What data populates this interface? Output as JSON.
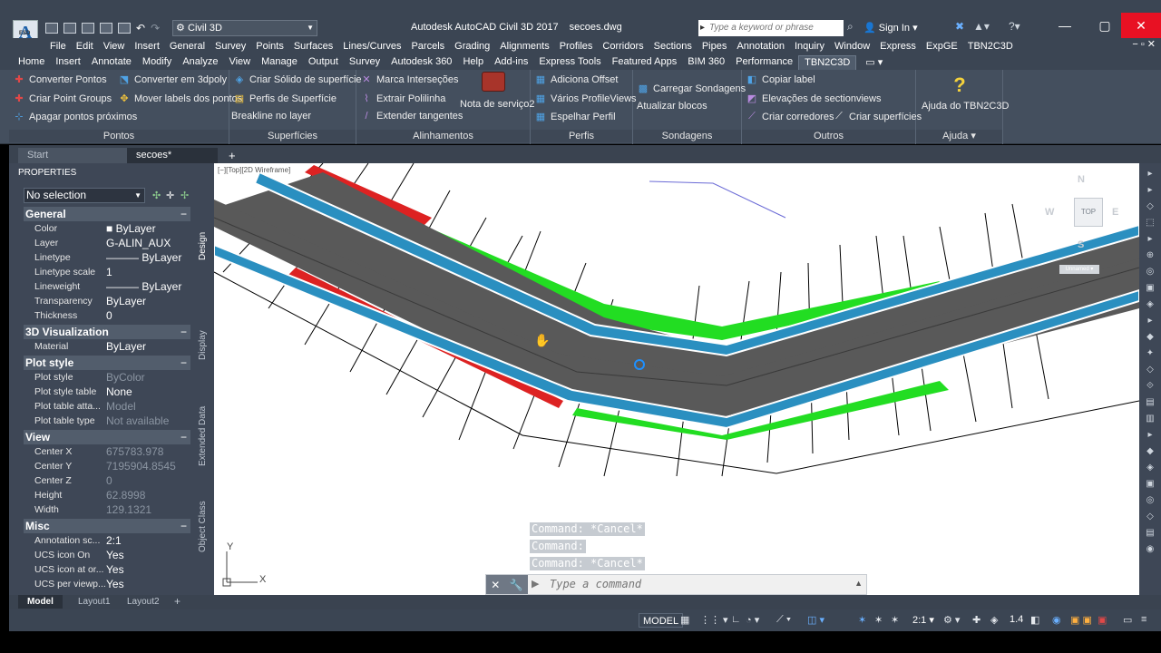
{
  "app": {
    "logo_letter": "A",
    "logo_sub": "ESD",
    "title": "Autodesk AutoCAD Civil 3D 2017",
    "filename": "secoes.dwg",
    "workspace": "Civil 3D",
    "search_placeholder": "Type a keyword or phrase",
    "sign_in": "Sign In"
  },
  "menubar": {
    "items": [
      "File",
      "Edit",
      "View",
      "Insert",
      "General",
      "Survey",
      "Points",
      "Surfaces",
      "Lines/Curves",
      "Parcels",
      "Grading",
      "Alignments",
      "Profiles",
      "Corridors",
      "Sections",
      "Pipes",
      "Annotation",
      "Inquiry",
      "Window",
      "Express",
      "ExpGE",
      "TBN2C3D"
    ],
    "close_glyph": "− ▫ ✕"
  },
  "ribbon_tabs": {
    "items": [
      "Home",
      "Insert",
      "Annotate",
      "Modify",
      "Analyze",
      "View",
      "Manage",
      "Output",
      "Survey",
      "Autodesk 360",
      "Help",
      "Add-ins",
      "Express Tools",
      "Featured Apps",
      "BIM 360",
      "Performance",
      "TBN2C3D"
    ],
    "active": "TBN2C3D",
    "extra": "▭ ▾"
  },
  "ribbon": {
    "pontos": {
      "title": "Pontos",
      "b1": "Converter Pontos",
      "b2": "Converter em 3dpoly",
      "b3": "Criar Point Groups",
      "b4": "Mover labels dos pontos",
      "b5": "Apagar pontos próximos"
    },
    "superficies": {
      "title": "Superfícies",
      "b1": "Criar Sólido de superfície",
      "b2": "Perfis de Superfície",
      "b3": "Breakline no layer"
    },
    "alinhamentos": {
      "title": "Alinhamentos",
      "b1": "Marca Interseções",
      "b2": "Extrair Polilinha",
      "b3": "Extender tangentes",
      "big": "Nota de serviço2"
    },
    "perfis": {
      "title": "Perfis",
      "b1": "Adiciona Offset",
      "b2": "Vários ProfileViews",
      "b3": "Espelhar Perfil"
    },
    "sondagens": {
      "title": "Sondagens",
      "b1": "Carregar Sondagens",
      "b2": "Atualizar blocos"
    },
    "outros": {
      "title": "Outros",
      "b1": "Copiar label",
      "b2": "Elevações de sectionviews",
      "b3": "Criar corredores",
      "b4": "Criar superfícies"
    },
    "ajuda": {
      "title": "Ajuda ▾",
      "big": "Ajuda do TBN2C3D"
    }
  },
  "file_tabs": {
    "start": "Start",
    "current": "secoes*",
    "add": "+"
  },
  "properties": {
    "header": "PROPERTIES",
    "selection": "No selection",
    "sections": [
      {
        "title": "General",
        "rows": [
          {
            "k": "Color",
            "v": "■ ByLayer",
            "dim": false
          },
          {
            "k": "Layer",
            "v": "G-ALIN_AUX",
            "dim": false
          },
          {
            "k": "Linetype",
            "v": "——— ByLayer",
            "dim": false
          },
          {
            "k": "Linetype scale",
            "v": "1",
            "dim": false
          },
          {
            "k": "Lineweight",
            "v": "——— ByLayer",
            "dim": false
          },
          {
            "k": "Transparency",
            "v": "ByLayer",
            "dim": false
          },
          {
            "k": "Thickness",
            "v": "0",
            "dim": false
          }
        ]
      },
      {
        "title": "3D Visualization",
        "rows": [
          {
            "k": "Material",
            "v": "ByLayer",
            "dim": false
          }
        ]
      },
      {
        "title": "Plot style",
        "rows": [
          {
            "k": "Plot style",
            "v": "ByColor",
            "dim": true
          },
          {
            "k": "Plot style table",
            "v": "None",
            "dim": false
          },
          {
            "k": "Plot table atta...",
            "v": "Model",
            "dim": true
          },
          {
            "k": "Plot table type",
            "v": "Not available",
            "dim": true
          }
        ]
      },
      {
        "title": "View",
        "rows": [
          {
            "k": "Center X",
            "v": "675783.978",
            "dim": true
          },
          {
            "k": "Center Y",
            "v": "7195904.8545",
            "dim": true
          },
          {
            "k": "Center Z",
            "v": "0",
            "dim": true
          },
          {
            "k": "Height",
            "v": "62.8998",
            "dim": true
          },
          {
            "k": "Width",
            "v": "129.1321",
            "dim": true
          }
        ]
      },
      {
        "title": "Misc",
        "rows": [
          {
            "k": "Annotation sc...",
            "v": "2:1",
            "dim": false
          },
          {
            "k": "UCS icon On",
            "v": "Yes",
            "dim": false
          },
          {
            "k": "UCS icon at or...",
            "v": "Yes",
            "dim": false
          },
          {
            "k": "UCS per viewp...",
            "v": "Yes",
            "dim": false
          }
        ]
      }
    ],
    "side_tabs": [
      "Design",
      "Display",
      "Extended Data",
      "Object Class"
    ]
  },
  "viewport": {
    "label": "[−][Top][2D Wireframe]",
    "viewcube": {
      "n": "N",
      "w": "W",
      "e": "E",
      "s": "S",
      "top": "TOP",
      "unnamed": "Unnamed ▾"
    },
    "ucs": {
      "x": "X",
      "y": "Y"
    },
    "colors": {
      "road": "#595959",
      "lane": "#2a8fc0",
      "fill_green": "#22dd22",
      "fill_red": "#dd2222",
      "line": "#000000"
    }
  },
  "command": {
    "history": [
      "Command: *Cancel*",
      "Command:",
      "Command: *Cancel*"
    ],
    "placeholder": "Type a command"
  },
  "layout_tabs": {
    "model": "Model",
    "l1": "Layout1",
    "l2": "Layout2",
    "add": "+"
  },
  "status": {
    "model": "MODEL",
    "scale": "2:1 ▾",
    "anno": "1.4"
  }
}
